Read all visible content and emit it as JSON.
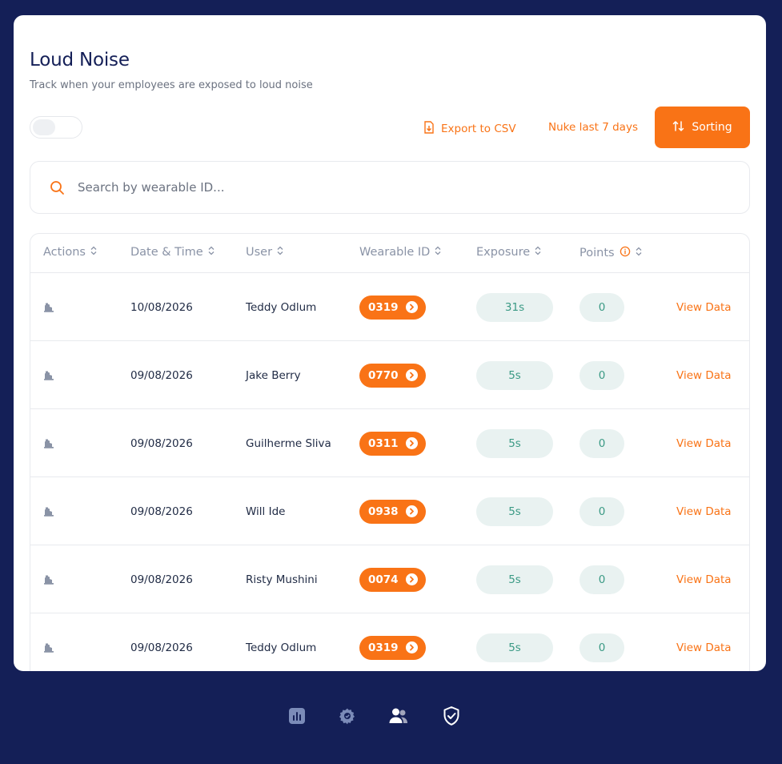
{
  "header": {
    "title": "Loud Noise",
    "subtitle": "Track when your employees are exposed to loud noise"
  },
  "toolbar": {
    "export_label": "Export to CSV",
    "nuke_label": "Nuke last 7 days",
    "sorting_label": "Sorting"
  },
  "search": {
    "placeholder": "Search by wearable ID..."
  },
  "table": {
    "columns": [
      "Actions",
      "Date & Time",
      "User",
      "Wearable ID",
      "Exposure",
      "Points"
    ],
    "rows": [
      {
        "date": "10/08/2026",
        "user": "Teddy Odlum",
        "wearable_id": "0319",
        "exposure": "31s",
        "points": "0",
        "action_label": "View Data"
      },
      {
        "date": "09/08/2026",
        "user": "Jake Berry",
        "wearable_id": "0770",
        "exposure": "5s",
        "points": "0",
        "action_label": "View Data"
      },
      {
        "date": "09/08/2026",
        "user": "Guilherme Sliva",
        "wearable_id": "0311",
        "exposure": "5s",
        "points": "0",
        "action_label": "View Data"
      },
      {
        "date": "09/08/2026",
        "user": "Will Ide",
        "wearable_id": "0938",
        "exposure": "5s",
        "points": "0",
        "action_label": "View Data"
      },
      {
        "date": "09/08/2026",
        "user": "Risty Mushini",
        "wearable_id": "0074",
        "exposure": "5s",
        "points": "0",
        "action_label": "View Data"
      },
      {
        "date": "09/08/2026",
        "user": "Teddy Odlum",
        "wearable_id": "0319",
        "exposure": "5s",
        "points": "0",
        "action_label": "View Data"
      }
    ]
  },
  "bottom_nav": {
    "icons": [
      "chart-icon",
      "gear-icon",
      "users-icon",
      "shield-check-icon"
    ]
  },
  "colors": {
    "background": "#141f57",
    "accent": "#f97316",
    "pill_bg": "#e9f2f1",
    "pill_text": "#3b9a85"
  }
}
